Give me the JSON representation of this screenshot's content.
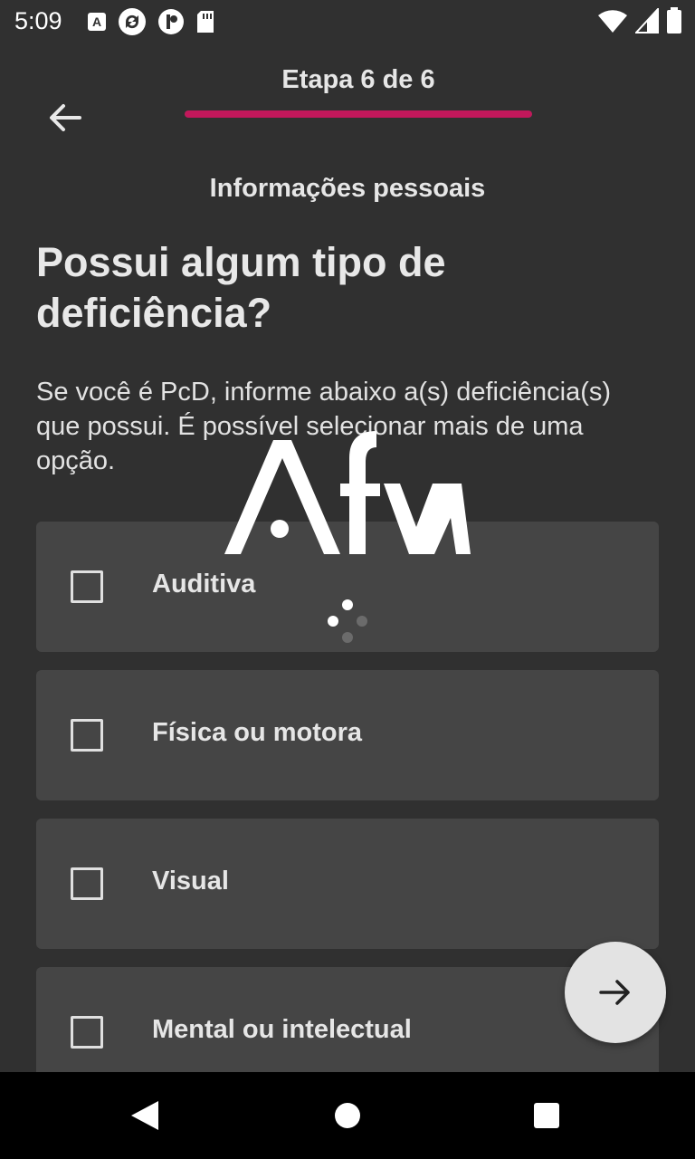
{
  "status_bar": {
    "time": "5:09",
    "left_icons": [
      "font-app-icon",
      "sync-app-icon",
      "profile-app-icon",
      "sd-card-icon"
    ],
    "right_icons": [
      "wifi-icon",
      "signal-icon",
      "battery-icon"
    ]
  },
  "header": {
    "step_label": "Etapa 6 de 6",
    "progress_fraction": 1.0,
    "progress_color": "#c2185b",
    "back_icon": "arrow-back-icon"
  },
  "section_title": "Informações pessoais",
  "question": "Possui algum tipo de deficiência?",
  "description": "Se você é PcD, informe abaixo a(s) deficiência(s) que possui. É possível selecionar mais de uma opção.",
  "options": [
    {
      "label": "Auditiva",
      "checked": false
    },
    {
      "label": "Física ou motora",
      "checked": false
    },
    {
      "label": "Visual",
      "checked": false
    },
    {
      "label": "Mental ou intelectual",
      "checked": false
    }
  ],
  "fab": {
    "icon": "arrow-forward-icon"
  },
  "overlay": {
    "logo_text": "Afya",
    "spinner": "loading-spinner"
  },
  "nav_bar": {
    "back": "nav-back-icon",
    "home": "nav-home-icon",
    "recents": "nav-recents-icon"
  }
}
